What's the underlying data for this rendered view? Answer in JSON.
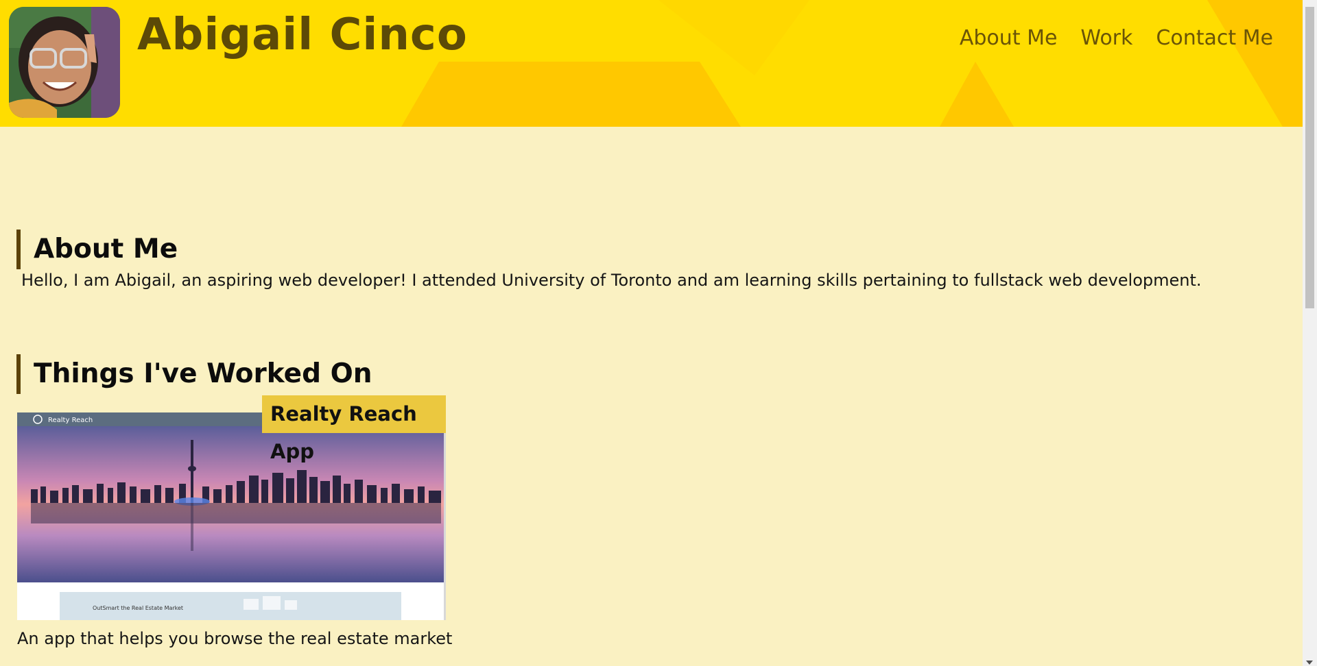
{
  "header": {
    "site_title": "Abigail Cinco",
    "nav": [
      {
        "label": "About Me"
      },
      {
        "label": "Work"
      },
      {
        "label": "Contact Me"
      }
    ],
    "colors": {
      "background": "#ffdd00",
      "shape": "#ffc400",
      "title": "#5c4a07"
    }
  },
  "about": {
    "heading": "About Me",
    "text": "Hello, I am Abigail, an aspiring web developer! I attended University of Toronto and am learning skills pertaining to fullstack web development."
  },
  "work": {
    "heading": "Things I've Worked On",
    "projects": [
      {
        "title": "Realty Reach App",
        "screenshot_brand": "Realty Reach",
        "screenshot_tagline": "OutSmart the Real Estate Market",
        "description": "An app that helps you browse the real estate market"
      }
    ]
  },
  "colors": {
    "page_background": "#faf1c2",
    "accent_border": "#5c4208",
    "badge": "#ebc83f"
  }
}
